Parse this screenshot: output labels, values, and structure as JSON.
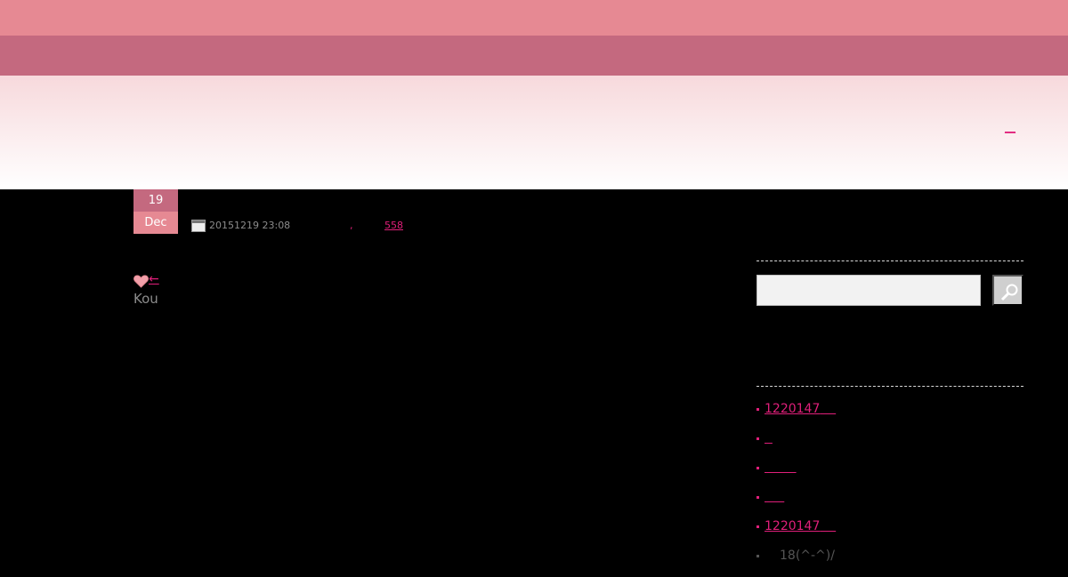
{
  "header": {
    "link_text": "__",
    "colors": {
      "topband": "#e68993",
      "navbar": "#c4697f",
      "link": "#e01f7a"
    }
  },
  "post": {
    "date_day": "19",
    "date_month": "Dec",
    "meta_datetime": "20151219 23:08",
    "meta_comma": ",",
    "meta_count": "558"
  },
  "nav": {
    "prev_arrow": "←",
    "author": "Kou"
  },
  "sidebar": {
    "search": {
      "placeholder": "",
      "icon": "search-icon"
    },
    "recent": [
      {
        "label": "1220147",
        "pad": "    "
      },
      {
        "label": "",
        "pad": "  "
      },
      {
        "label": "",
        "pad": "        "
      },
      {
        "label": "",
        "pad": "     "
      },
      {
        "label": "1220147",
        "pad": "    "
      }
    ],
    "recent_plain": "18(^-^)/"
  }
}
